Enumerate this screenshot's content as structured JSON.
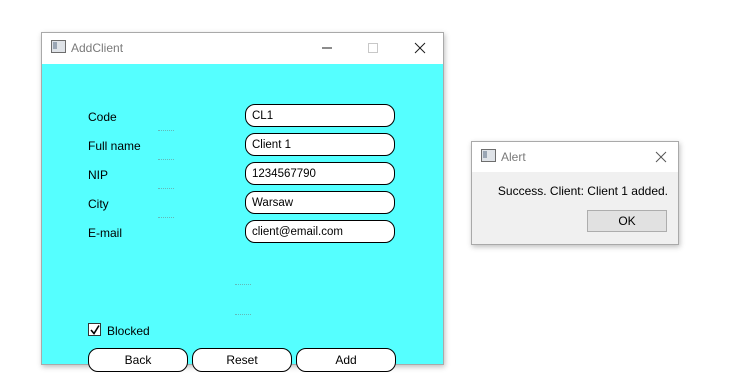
{
  "main_window": {
    "title": "AddClient",
    "fields": [
      {
        "label": "Code",
        "value": "CL1"
      },
      {
        "label": "Full name",
        "value": "Client 1"
      },
      {
        "label": "NIP",
        "value": "1234567790"
      },
      {
        "label": "City",
        "value": "Warsaw"
      },
      {
        "label": "E-mail",
        "value": "client@email.com"
      }
    ],
    "blocked": {
      "label": "Blocked",
      "checked": true
    },
    "buttons": {
      "back": "Back",
      "reset": "Reset",
      "add": "Add"
    },
    "background_color": "#55ffff"
  },
  "alert": {
    "title": "Alert",
    "message": "Success. Client: Client 1 added.",
    "ok_label": "OK"
  }
}
